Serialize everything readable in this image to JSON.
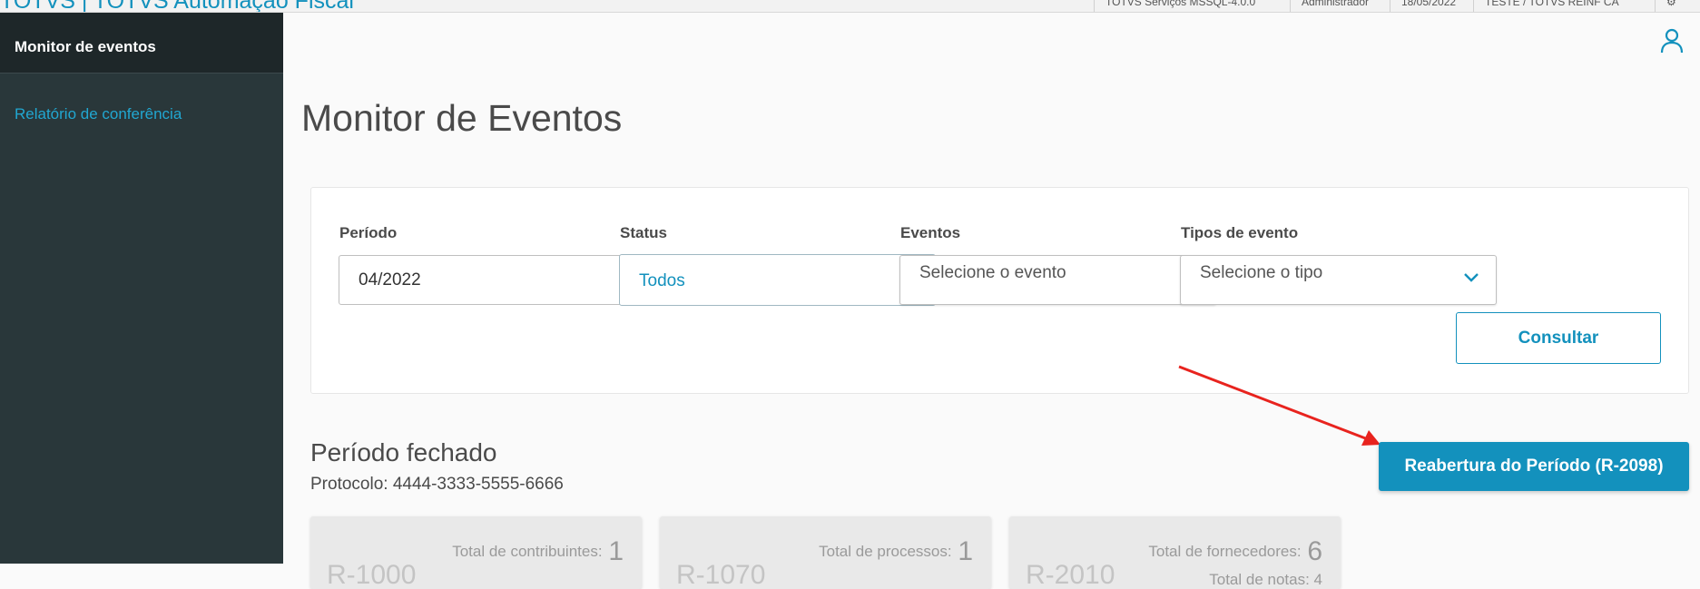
{
  "topbar": {
    "brand": "TOTVS | TOTVS Automação Fiscal",
    "items": [
      "TOTVS Serviços MSSQL-4.0.0",
      "Administrador",
      "18/05/2022",
      "TESTE / TOTVS REINF CA",
      "⚙"
    ]
  },
  "sidebar": {
    "active_item": "Monitor de eventos",
    "items": [
      {
        "label": "Relatório de conferência"
      }
    ]
  },
  "page": {
    "title": "Monitor de Eventos"
  },
  "filters": {
    "periodo": {
      "label": "Período",
      "value": "04/2022"
    },
    "status": {
      "label": "Status",
      "value": "Todos"
    },
    "eventos": {
      "label": "Eventos",
      "placeholder": "Selecione o evento"
    },
    "tipos": {
      "label": "Tipos de evento",
      "placeholder": "Selecione o tipo"
    },
    "consultar_label": "Consultar"
  },
  "period": {
    "title": "Período fechado",
    "protocol": "Protocolo: 4444-3333-5555-6666",
    "reopen_label": "Reabertura do Período (R-2098)"
  },
  "summary_cards": [
    {
      "code": "R-1000",
      "stat_label": "Total de contribuintes:",
      "stat_value": "1"
    },
    {
      "code": "R-1070",
      "stat_label": "Total de processos:",
      "stat_value": "1"
    },
    {
      "code": "R-2010",
      "stat_label": "Total de fornecedores:",
      "stat_value": "6",
      "stat2": "Total de notas: 4"
    }
  ],
  "colors": {
    "accent": "#1391bd",
    "sidebar": "#29373a",
    "arrow": "#e8231e"
  }
}
